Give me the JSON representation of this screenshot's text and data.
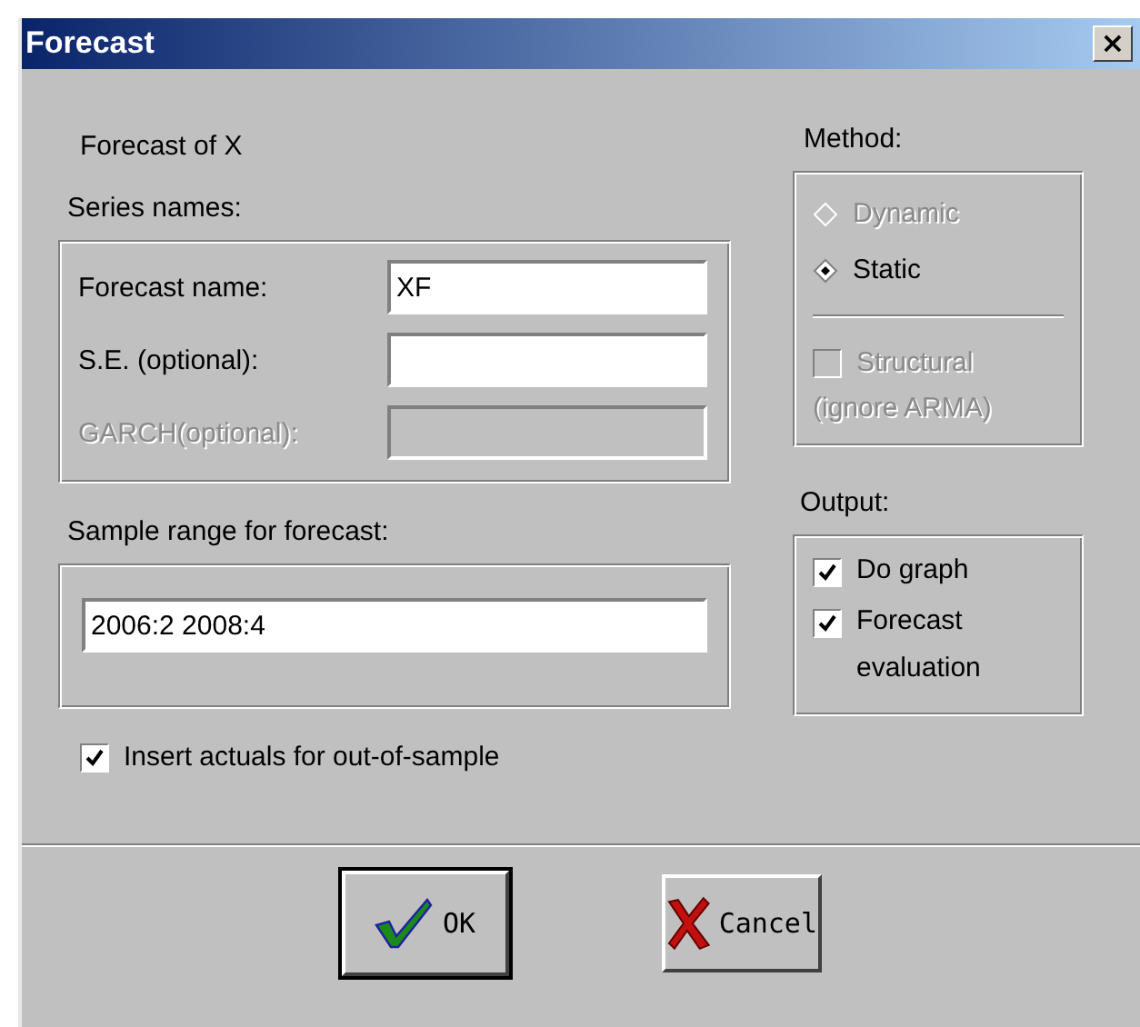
{
  "window": {
    "title": "Forecast",
    "close": "×"
  },
  "subtitle": "Forecast of X",
  "series": {
    "title": "Series names:",
    "fields": [
      {
        "label": "Forecast name:",
        "value": "XF",
        "disabled": false
      },
      {
        "label": "S.E. (optional):",
        "disabled": false
      },
      {
        "label": "GARCH(optional):",
        "disabled": true
      }
    ]
  },
  "sample": {
    "title": "Sample range for forecast:",
    "value": "2006:2 2008:4"
  },
  "insert_actuals": {
    "label": "Insert actuals for out-of-sample",
    "checked": true
  },
  "method": {
    "title": "Method:",
    "options": [
      {
        "label": "Dynamic",
        "selected": false,
        "disabled": true
      },
      {
        "label": "Static",
        "selected": true,
        "disabled": false
      }
    ],
    "structural": {
      "label": "Structural",
      "note": "(ignore ARMA)",
      "checked": false,
      "disabled": true
    }
  },
  "output": {
    "title": "Output:",
    "options": [
      {
        "label": "Do graph",
        "checked": true
      },
      {
        "label": "Forecast evaluation",
        "checked": true
      }
    ]
  },
  "buttons": [
    {
      "kind": "ok",
      "label": "OK",
      "default": true
    },
    {
      "kind": "cancel",
      "label": "Cancel",
      "default": false
    }
  ]
}
